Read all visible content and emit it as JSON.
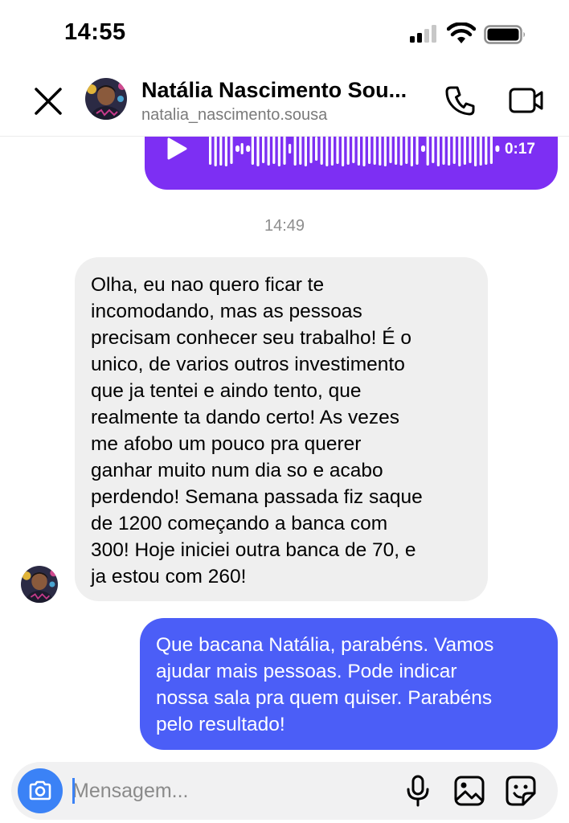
{
  "status_bar": {
    "time": "14:55",
    "icons": [
      "cellular-signal-icon",
      "wifi-icon",
      "battery-icon"
    ]
  },
  "header": {
    "contact_name": "Natália Nascimento Sou...",
    "contact_handle": "natalia_nascimento.sousa",
    "icons": [
      "close-icon",
      "phone-icon",
      "video-camera-icon"
    ]
  },
  "conversation": {
    "audio_message": {
      "duration": "0:17",
      "bubble_color": "#7d2ff3",
      "icon": "play-icon"
    },
    "timestamp": "14:49",
    "incoming_message": {
      "lines": [
        "Olha, eu nao quero ficar te",
        "incomodando, mas as pessoas",
        "precisam conhecer seu trabalho! É o",
        "unico, de varios outros investimento",
        "que ja tentei e aindo tento, que",
        "realmente ta dando certo! As vezes",
        "me afobo um pouco pra querer",
        "ganhar muito num dia so e acabo",
        "perdendo! Semana passada fiz saque",
        "de 1200 começando a banca com",
        "300! Hoje iniciei outra banca de 70, e",
        "ja estou com 260!"
      ],
      "bubble_color": "#efefef"
    },
    "outgoing_message": {
      "lines": [
        "Que bacana Natália, parabéns. Vamos",
        "ajudar mais pessoas. Pode indicar",
        "nossa sala pra quem quiser. Parabéns",
        "pelo resultado!"
      ],
      "bubble_color": "#4b5ef7"
    }
  },
  "composer": {
    "placeholder": "Mensagem...",
    "value": "",
    "icons": [
      "camera-icon",
      "microphone-icon",
      "image-gallery-icon",
      "sticker-icon"
    ],
    "camera_button_color": "#3b82f6"
  }
}
